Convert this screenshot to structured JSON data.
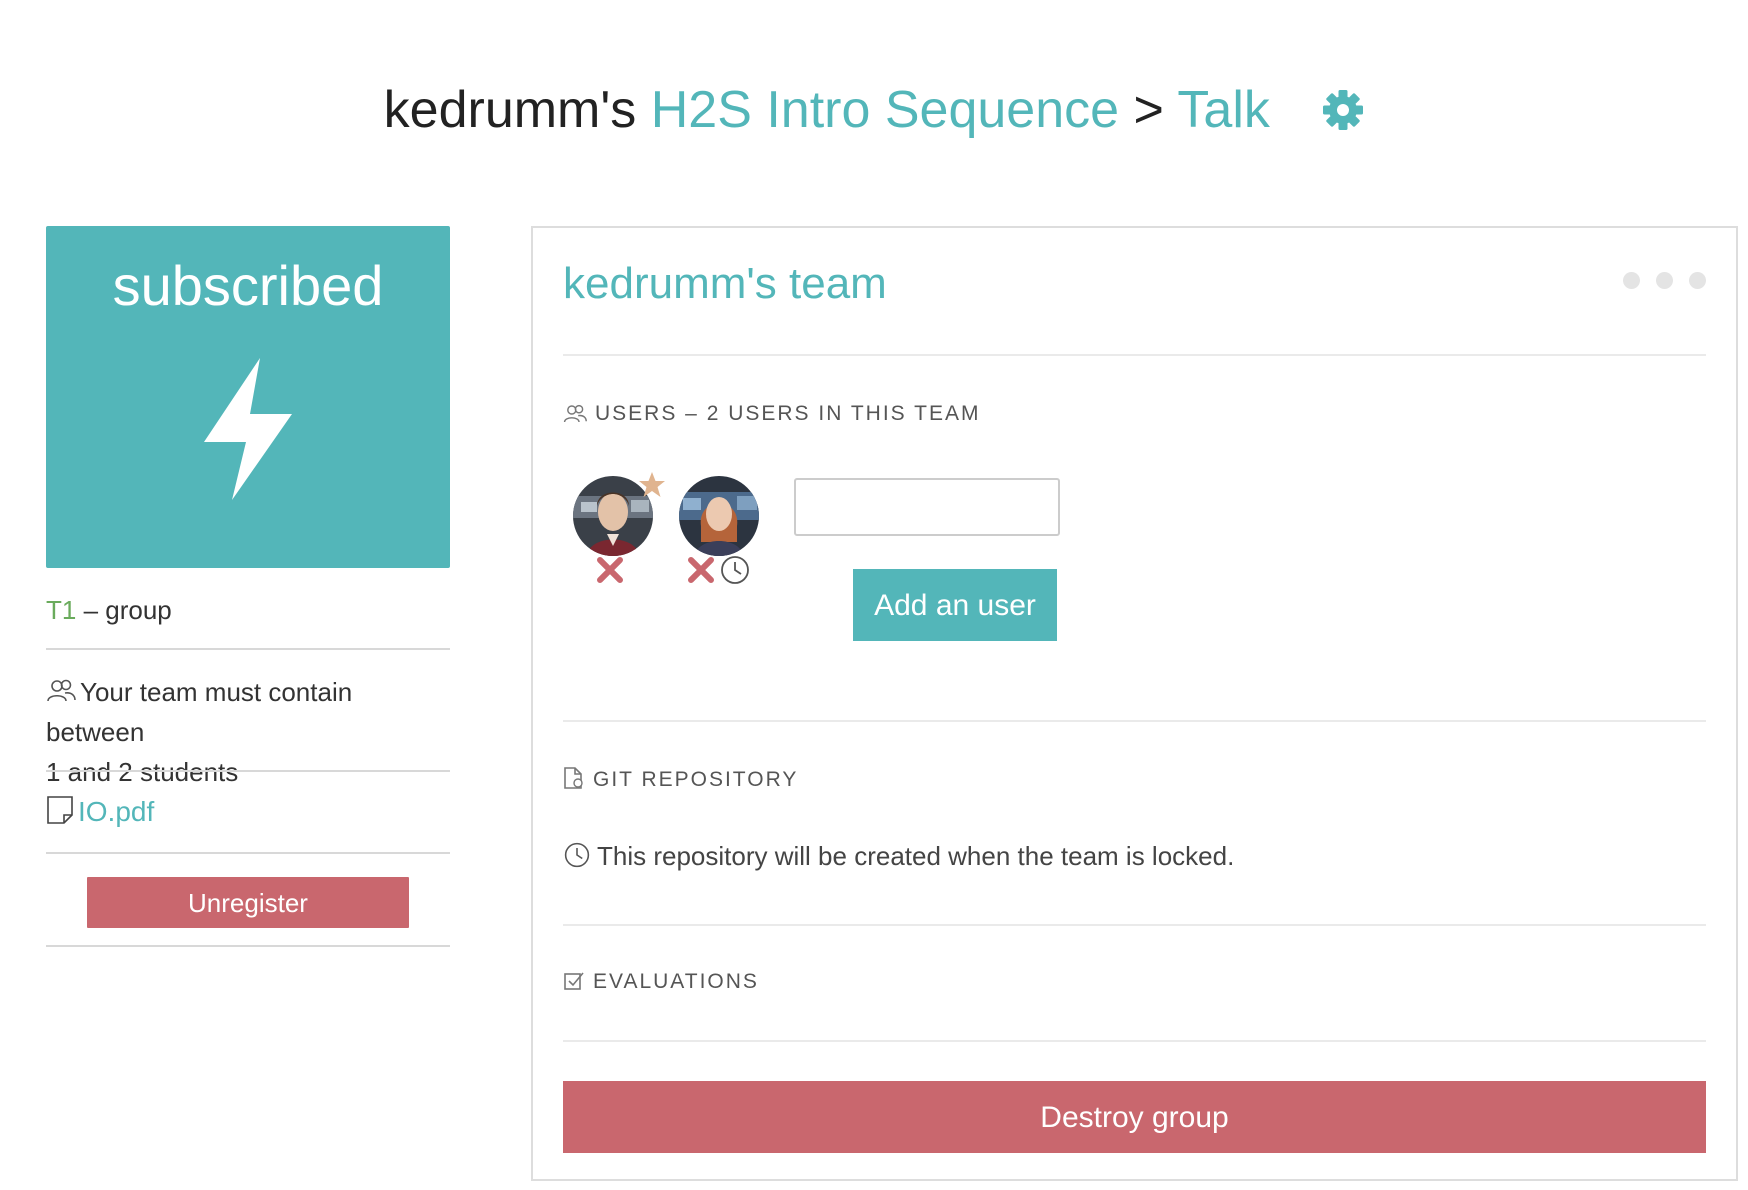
{
  "header": {
    "owner": "kedrumm's",
    "project": "H2S Intro Sequence",
    "separator": ">",
    "activity": "Talk",
    "settings_icon": "gear-icon"
  },
  "colors": {
    "accent": "#53b6b9",
    "danger": "#c9676e",
    "group_code": "#6aab5c",
    "star": "#e0b48f"
  },
  "sidebar": {
    "status_label": "subscribed",
    "status_icon": "lightning-bolt-icon",
    "group_code": "T1",
    "group_type": "– group",
    "team_rule_line1": "Your team must contain between",
    "team_rule_line2": "1 and 2 students",
    "attachment": "IO.pdf",
    "unregister_label": "Unregister"
  },
  "team": {
    "name": "kedrumm's team",
    "users_heading": "USERS – 2 USERS IN THIS TEAM",
    "user_input_value": "",
    "add_user_label": "Add an user",
    "repo_heading": "GIT REPOSITORY",
    "repo_text": "This repository will be created when the team is locked.",
    "evaluations_heading": "EVALUATIONS",
    "destroy_label": "Destroy group"
  }
}
